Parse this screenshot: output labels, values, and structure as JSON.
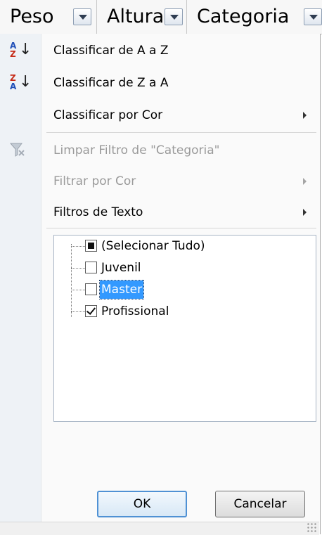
{
  "header": {
    "columns": [
      {
        "label": "Peso"
      },
      {
        "label": "Altura"
      },
      {
        "label": "Categoria"
      }
    ]
  },
  "menu": {
    "sort_az": {
      "label": "Classificar de A a Z",
      "icon": "sort-ascending-icon",
      "letters": [
        "A",
        "Z"
      ]
    },
    "sort_za": {
      "label": "Classificar de Z a A",
      "icon": "sort-descending-icon",
      "letters": [
        "Z",
        "A"
      ]
    },
    "sort_color": {
      "label": "Classificar por Cor"
    },
    "clear_filter": {
      "label": "Limpar Filtro de \"Categoria\"",
      "icon": "clear-filter-icon",
      "enabled": false
    },
    "filter_color": {
      "label": "Filtrar por Cor",
      "enabled": false
    },
    "text_filters": {
      "label": "Filtros de Texto"
    }
  },
  "list": {
    "items": [
      {
        "label": "(Selecionar Tudo)",
        "state": "partial"
      },
      {
        "label": "Juvenil",
        "state": "unchecked"
      },
      {
        "label": "Master",
        "state": "unchecked",
        "selected": true
      },
      {
        "label": "Profissional",
        "state": "checked"
      }
    ]
  },
  "buttons": {
    "ok": "OK",
    "cancel": "Cancelar"
  },
  "colors": {
    "selection": "#3399ff",
    "default_button_border": "#4f91d4",
    "disabled_text": "#9a9a9a"
  }
}
